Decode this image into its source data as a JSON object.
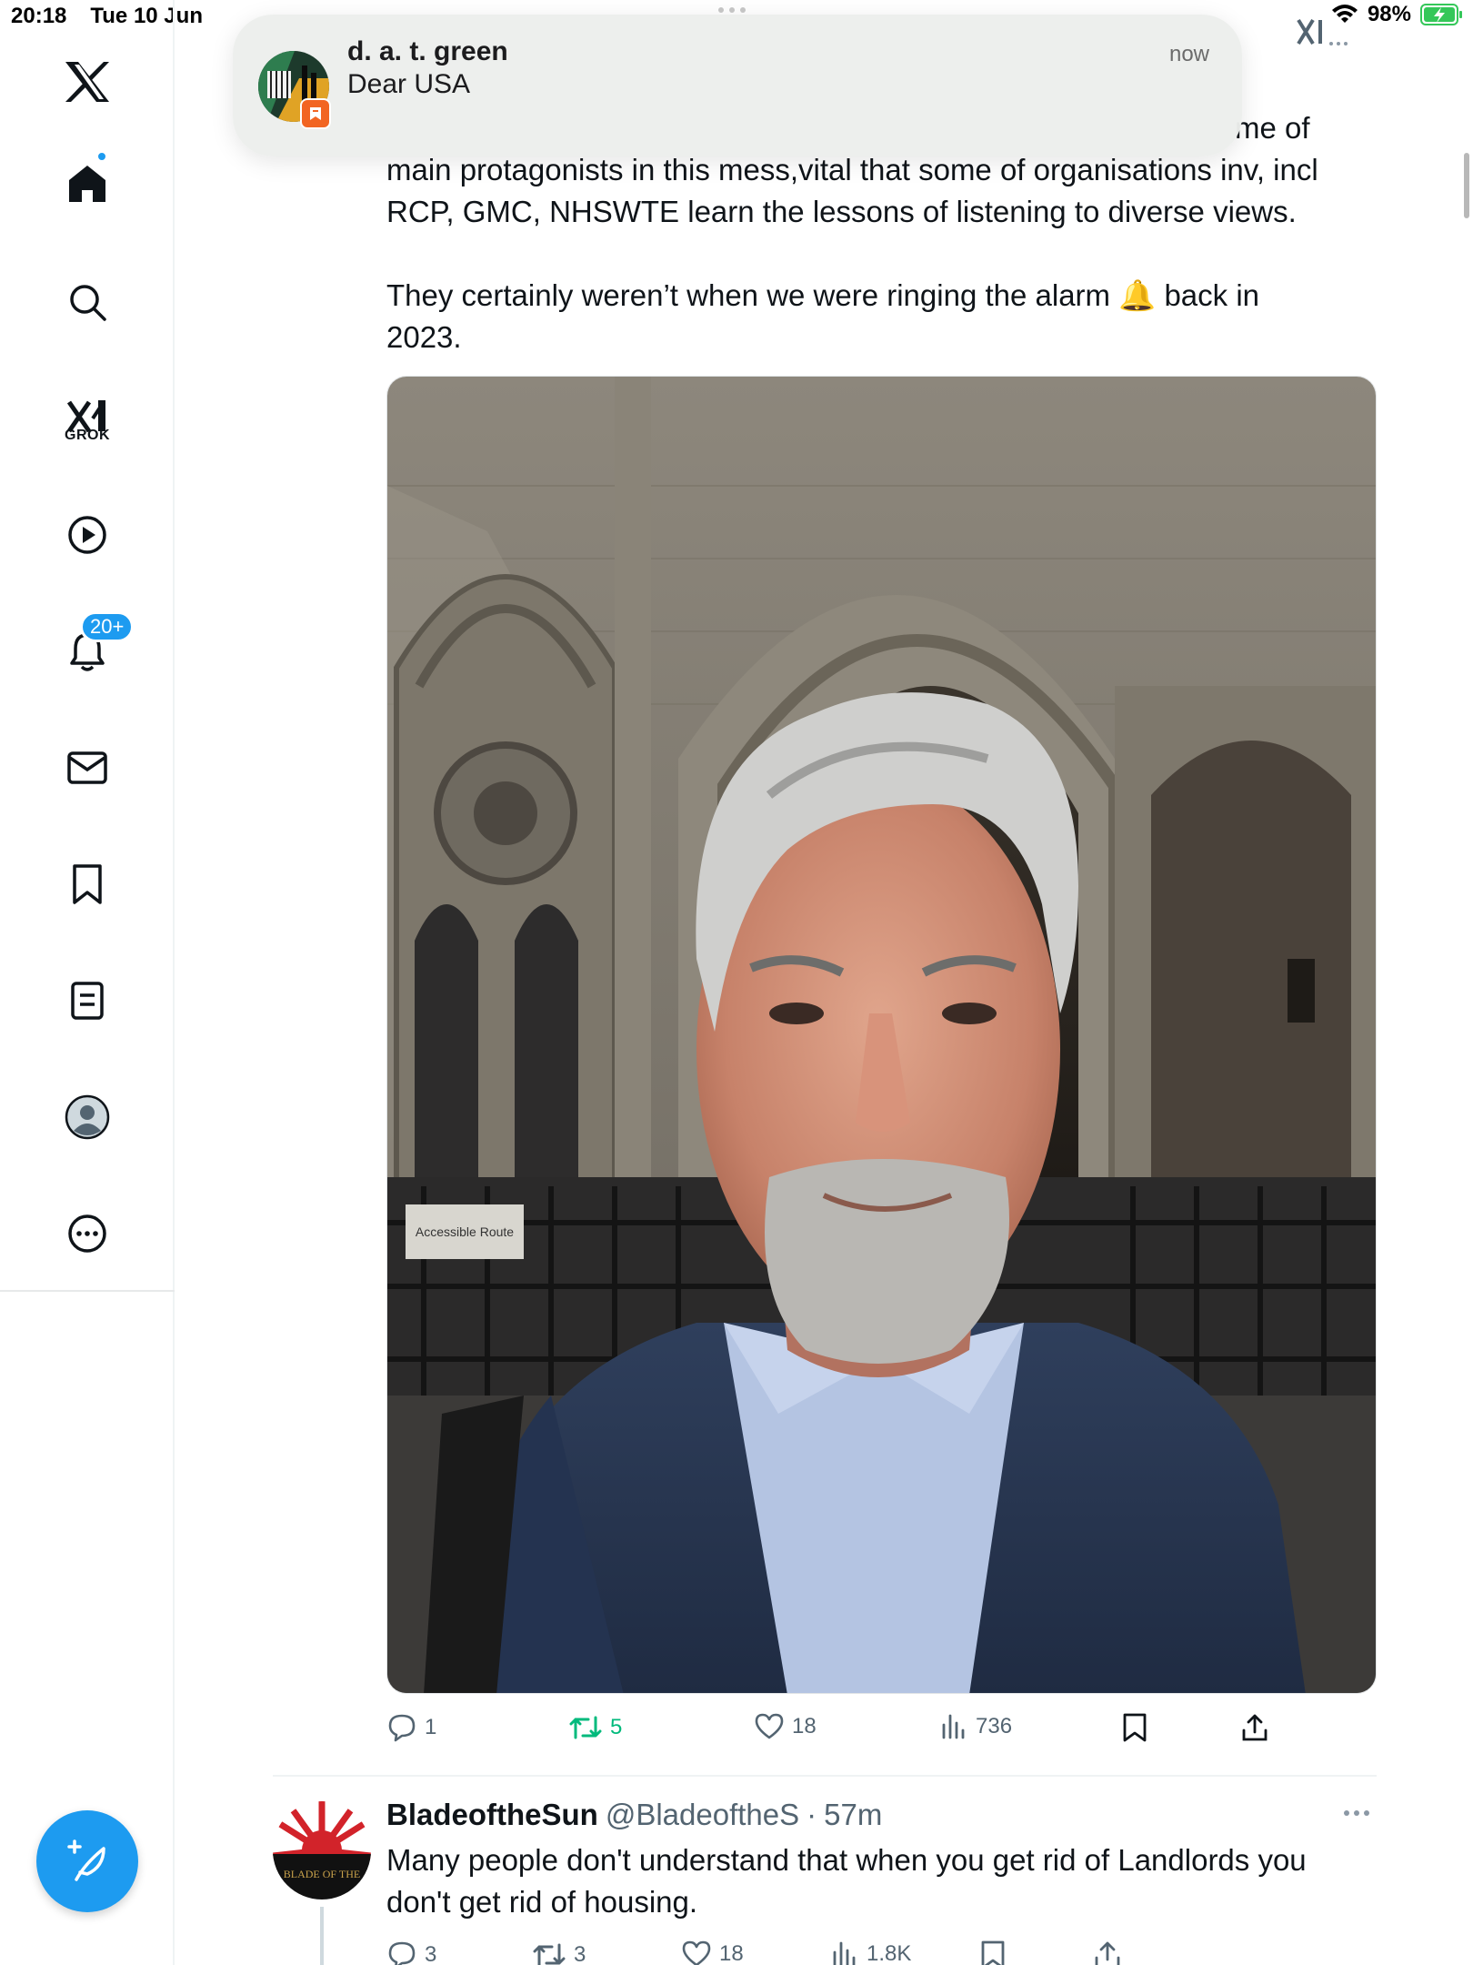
{
  "status_bar": {
    "time": "20:18",
    "date": "Tue 10 Jun",
    "battery": "98%"
  },
  "sidebar": {
    "grok_label": "GROK",
    "notifications_badge": "20+"
  },
  "notification_banner": {
    "title": "d. a. t. green",
    "body": "Dear USA",
    "time": "now"
  },
  "tweet": {
    "text_partial": "me of",
    "text_line2": "main protagonists in this mess,vital that some of organisations inv, incl",
    "text_line3": "RCP, GMC, NHSWTE learn the lessons of listening to diverse views.",
    "text_line4": "They certainly weren’t when we were ringing the alarm 🔔 back in",
    "text_line5": "2023.",
    "photo_sign_text": "Accessible Route",
    "actions": {
      "replies": "1",
      "reposts": "5",
      "likes": "18",
      "views": "736"
    }
  },
  "tweet2": {
    "name": "BladeoftheSun",
    "handle": "@BladeoftheS",
    "separator": "·",
    "time": "57m",
    "text_line1": "Many people don't understand that when you get rid of Landlords you",
    "text_line2": "don't get rid of housing.",
    "avatar_text": "BLADE OF THE",
    "actions": {
      "replies": "3",
      "reposts": "3",
      "likes": "18",
      "views": "1.8K"
    }
  },
  "colors": {
    "accent": "#1d9bf0",
    "repost_active": "#00ba7c",
    "muted": "#536471"
  }
}
